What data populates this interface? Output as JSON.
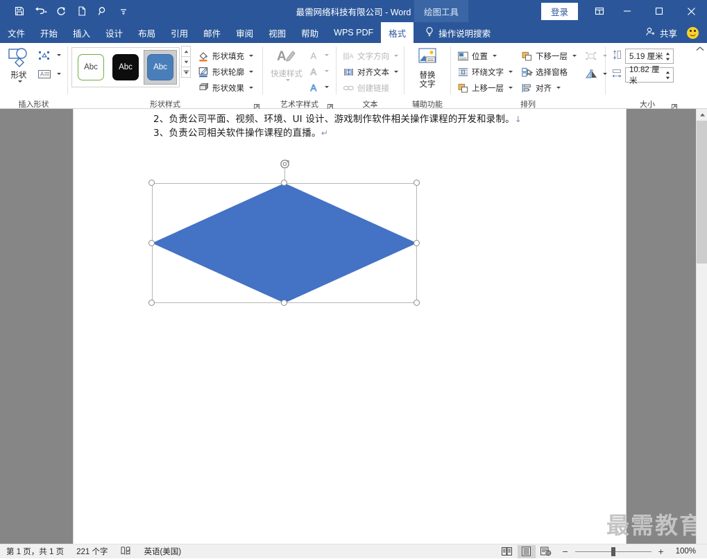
{
  "titlebar": {
    "document_title": "最需网络科技有限公司  -  Word",
    "contextual_tab": "绘图工具",
    "signin_label": "登录",
    "qat": [
      {
        "name": "save-icon",
        "tooltip": "保存"
      },
      {
        "name": "undo-icon",
        "tooltip": "撤消"
      },
      {
        "name": "redo-icon",
        "tooltip": "重复"
      },
      {
        "name": "new-doc-icon",
        "tooltip": "新建"
      },
      {
        "name": "search-icon",
        "tooltip": "搜索"
      },
      {
        "name": "customize-qat-icon",
        "tooltip": "自定义快速访问工具栏"
      }
    ],
    "window_controls": [
      "restore-ribbon",
      "minimize",
      "maximize",
      "close"
    ]
  },
  "tabs": [
    {
      "label": "文件",
      "active": false
    },
    {
      "label": "开始",
      "active": false
    },
    {
      "label": "插入",
      "active": false
    },
    {
      "label": "设计",
      "active": false
    },
    {
      "label": "布局",
      "active": false
    },
    {
      "label": "引用",
      "active": false
    },
    {
      "label": "邮件",
      "active": false
    },
    {
      "label": "审阅",
      "active": false
    },
    {
      "label": "视图",
      "active": false
    },
    {
      "label": "帮助",
      "active": false
    },
    {
      "label": "WPS PDF",
      "active": false
    },
    {
      "label": "格式",
      "active": true
    }
  ],
  "tellme": {
    "label": "操作说明搜索"
  },
  "share": {
    "label": "共享"
  },
  "ribbon": {
    "insert_shapes": {
      "group_label": "插入形状",
      "shapes_button": "形状",
      "edit_shape_tooltip": "编辑形状",
      "textbox_tooltip": "文本框"
    },
    "shape_styles": {
      "group_label": "形状样式",
      "gallery": [
        {
          "label": "Abc",
          "style": "outline-green",
          "selected": false
        },
        {
          "label": "Abc",
          "style": "filled-black",
          "selected": false
        },
        {
          "label": "Abc",
          "style": "filled-blue",
          "selected": true
        }
      ],
      "fill_label": "形状填充",
      "outline_label": "形状轮廓",
      "effects_label": "形状效果",
      "fill_color": "#ED7D31",
      "outline_color": "#4472C4"
    },
    "wordart_styles": {
      "group_label": "艺术字样式",
      "quick_styles_label": "快速样式",
      "text_fill_tooltip": "文本填充",
      "text_outline_tooltip": "文本轮廓",
      "text_effects_tooltip": "文本效果"
    },
    "text": {
      "group_label": "文本",
      "items": [
        {
          "label": "文字方向",
          "disabled": true
        },
        {
          "label": "对齐文本",
          "disabled": false
        },
        {
          "label": "创建链接",
          "disabled": true
        }
      ]
    },
    "accessibility": {
      "group_label": "辅助功能",
      "alt_text_line1": "替换",
      "alt_text_line2": "文字"
    },
    "arrange": {
      "group_label": "排列",
      "col1": [
        {
          "label": "位置",
          "has_caret": true
        },
        {
          "label": "环绕文字",
          "has_caret": true
        },
        {
          "label": "上移一层",
          "has_caret": true
        }
      ],
      "col2": [
        {
          "label": "下移一层",
          "has_caret": true
        },
        {
          "label": "选择窗格",
          "has_caret": false
        },
        {
          "label": "对齐",
          "has_caret": true
        }
      ],
      "col3": [
        {
          "tooltip": "组合",
          "disabled": true
        },
        {
          "tooltip": "旋转",
          "disabled": false
        }
      ]
    },
    "size": {
      "group_label": "大小",
      "height_value": "5.19 厘米",
      "width_value": "10.82 厘米",
      "height_tooltip": "形状高度",
      "width_tooltip": "形状宽度"
    }
  },
  "document": {
    "lines": [
      {
        "text": "2、负责公司平面、视频、环境、UI 设计、游戏制作软件相关操作课程的开发和录制。",
        "mark": "↓"
      },
      {
        "text": "3、负责公司相关软件操作课程的直播。",
        "mark": "↵"
      }
    ],
    "watermark": "最需教育",
    "shape": {
      "type": "diamond",
      "fill_color": "#4472C4",
      "selected": true,
      "handle_count": 8,
      "rotation_handle": true
    }
  },
  "statusbar": {
    "page_info": "第 1 页，共 1 页",
    "word_count": "221 个字",
    "proofing_tooltip": "校对错误",
    "language": "英语(美国)",
    "views": [
      {
        "name": "read-mode",
        "active": false
      },
      {
        "name": "print-layout",
        "active": true
      },
      {
        "name": "web-layout",
        "active": false
      }
    ],
    "zoom_out": "−",
    "zoom_in": "+",
    "zoom_level": "100%"
  }
}
